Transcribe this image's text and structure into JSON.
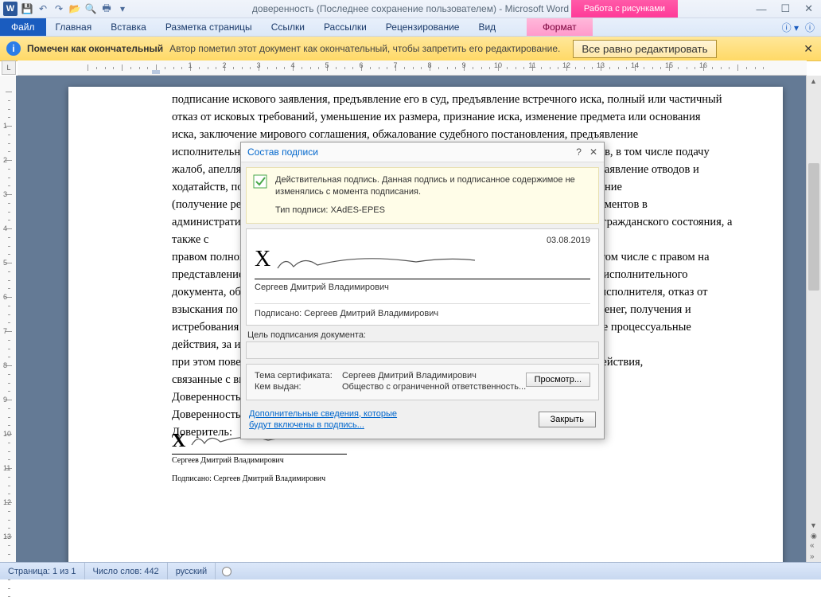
{
  "titlebar": {
    "doc_title": "доверенность (Последнее сохранение пользователем)  -  Microsoft Word",
    "context_tool": "Работа с рисунками"
  },
  "ribbon": {
    "file": "Файл",
    "tabs": [
      "Главная",
      "Вставка",
      "Разметка страницы",
      "Ссылки",
      "Рассылки",
      "Рецензирование",
      "Вид"
    ],
    "format": "Формат"
  },
  "infobar": {
    "bold": "Помечен как окончательный",
    "text": "Автор пометил этот документ как окончательный, чтобы запретить его редактирование.",
    "button": "Все равно редактировать"
  },
  "document": {
    "body_lines": [
      "подписание искового заявления, предъявление его в суд, предъявление встречного иска, полный или частичный",
      "отказ от исковых требований, уменьшение их размера, признание иска, изменение предмета или основания",
      "иска, заключение мирового соглашения, обжалование судебного постановления, предъявление",
      "исполнительного документа к взысканию, с правом на подачу любых других документов, в том числе подачу",
      "жалоб, апелляционной жалобы, кассационной жалобы, надзорной жалобы, заявлений, заявление отводов и",
      "ходатайств, подписание и подачу мировых соглашений и заявлений, с правом на получение",
      "(получение решений, определений, исполнительных листов и судебных приказов), документов в",
      "административном порядке, включая документы о государственной регистрации актов гражданского состояния, а также с",
      "правом полного представительства моих интересов в исполнительном производстве, в том числе с правом на",
      "представление и отзыв исполнительных документов, а также с правом на подачу отзыв исполнительного",
      "документа, обжалование действий (бездействия) и постановлений судебного пристава-исполнителя, отказ от",
      "взыскания по исполнительному документу, получение присужденного имущества или денег, получения и",
      "истребования имущества и денежных средств, с правом совершать от моего имени иные процессуальные",
      "действия, за исключением передоверия полномочий другим лицам,",
      "при этом поверенный вправе лично подписывать, подавать, получать и совершать все действия,",
      "связанные с выполнением данного поручения.",
      "Доверенность выдана с правом передоверия.",
      "Доверенность действительна в течение трёх лет.",
      "Доверитель:"
    ],
    "sig_name": "Сергеев Дмитрий Владимирович",
    "sig_signed": "Подписано: Сергеев Дмитрий Владимирович"
  },
  "dialog": {
    "title": "Состав подписи",
    "yellow1": "Действительная подпись. Данная подпись и подписанное содержимое не изменялись с момента подписания.",
    "yellow2": "Тип подписи: XAdES-EPES",
    "date": "03.08.2019",
    "signer_name": "Сергеев Дмитрий Владимирович",
    "signed_by_label": "Подписано: ",
    "signed_by": "Сергеев Дмитрий Владимирович",
    "purpose_label": "Цель подписания документа:",
    "cert_theme_label": "Тема сертификата:",
    "cert_theme": "Сергеев Дмитрий Владимирович",
    "cert_issuer_label": "Кем выдан:",
    "cert_issuer": "Общество с ограниченной ответственность...",
    "view_btn": "Просмотр...",
    "more_link1": "Дополнительные сведения, которые",
    "more_link2": "будут включены в подпись...",
    "close_btn": "Закрыть"
  },
  "statusbar": {
    "page": "Страница: 1 из 1",
    "words": "Число слов: 442",
    "lang": "русский"
  }
}
